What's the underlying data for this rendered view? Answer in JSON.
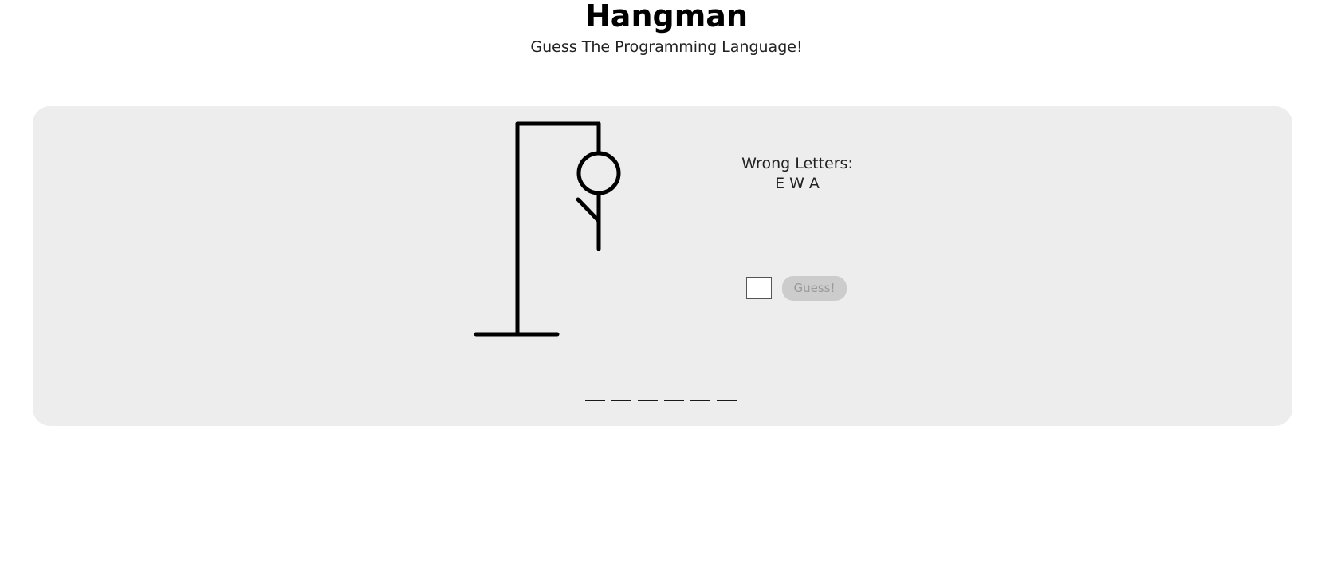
{
  "header": {
    "title": "Hangman",
    "subtitle": "Guess The Programming Language!"
  },
  "game": {
    "wrong_label": "Wrong Letters:",
    "wrong_letters": "E W A",
    "wrong_count": 3,
    "guess_input_value": "",
    "guess_button_label": "Guess!",
    "word_length": 6,
    "revealed_letters": [
      "",
      "",
      "",
      "",
      "",
      ""
    ]
  },
  "colors": {
    "panel_background": "#ededed",
    "figure_stroke": "#000000",
    "button_background": "#cccccc",
    "button_text": "#9a9a9a"
  }
}
